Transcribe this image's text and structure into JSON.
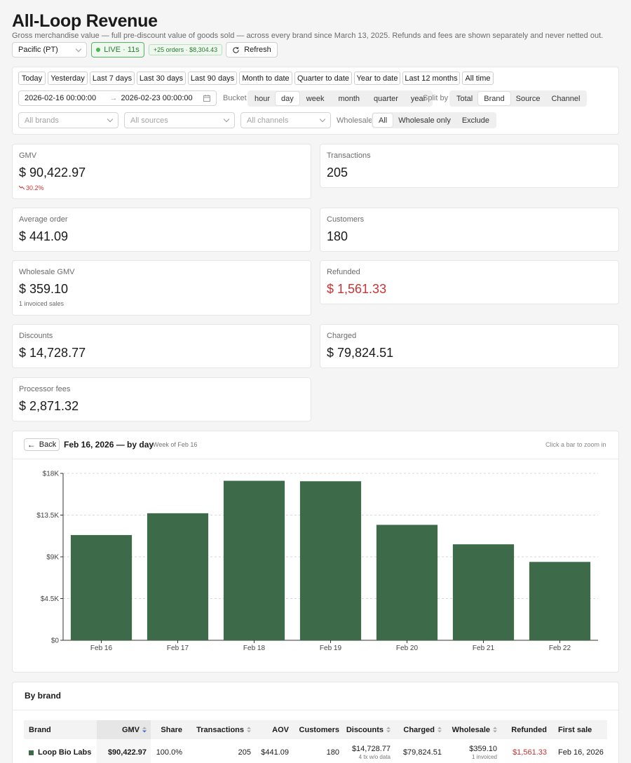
{
  "header": {
    "title": "All-Loop Revenue",
    "subtitle": "Gross merchandise value — full pre-discount value of goods sold — across every brand since March 13, 2025. Refunds and fees are shown separately and never netted out."
  },
  "toolbar": {
    "timezone": "Pacific (PT)",
    "live_label": "LIVE · 11s",
    "new_orders": "+25 orders · $8,304.43",
    "refresh_label": "Refresh"
  },
  "filters": {
    "quick_ranges": [
      "Today",
      "Yesterday",
      "Last 7 days",
      "Last 30 days",
      "Last 90 days",
      "Month to date",
      "Quarter to date",
      "Year to date",
      "Last 12 months",
      "All time"
    ],
    "date_from": "2026-02-16 00:00:00",
    "date_arrow": "→",
    "date_to": "2026-02-23 00:00:00",
    "bucket_label": "Bucket",
    "buckets": [
      "hour",
      "day",
      "week",
      "month",
      "quarter",
      "year"
    ],
    "bucket_selected": "day",
    "split_label": "Split by",
    "splits": [
      "Total",
      "Brand",
      "Source",
      "Channel"
    ],
    "split_selected": "Brand",
    "brands_placeholder": "All brands",
    "sources_placeholder": "All sources",
    "channels_placeholder": "All channels",
    "wholesale_label": "Wholesale",
    "wholesale_options": [
      "All",
      "Wholesale only",
      "Exclude"
    ],
    "wholesale_selected": "All"
  },
  "stats": {
    "gmv": {
      "label": "GMV",
      "value": "$ 90,422.97",
      "delta": "30.2%",
      "delta_color": "#c93333"
    },
    "transactions": {
      "label": "Transactions",
      "value": "205"
    },
    "average_order": {
      "label": "Average order",
      "value": "$ 441.09"
    },
    "customers": {
      "label": "Customers",
      "value": "180"
    },
    "wholesale_gmv": {
      "label": "Wholesale GMV",
      "value": "$ 359.10",
      "note": "1 invoiced sales"
    },
    "refunded": {
      "label": "Refunded",
      "value": "$ 1,561.33",
      "color": "#c93333"
    },
    "discounts": {
      "label": "Discounts",
      "value": "$ 14,728.77"
    },
    "charged": {
      "label": "Charged",
      "value": "$ 79,824.51"
    },
    "processor_fees": {
      "label": "Processor fees",
      "value": "$ 2,871.32"
    }
  },
  "chart_panel": {
    "back_label": "Back",
    "title": "Feb 16, 2026 — by day",
    "subtitle": "Week of Feb 16",
    "hint": "Click a bar to zoom in"
  },
  "chart_data": {
    "type": "bar",
    "categories": [
      "Feb 16",
      "Feb 17",
      "Feb 18",
      "Feb 19",
      "Feb 20",
      "Feb 21",
      "Feb 22"
    ],
    "values": [
      11350,
      13700,
      17200,
      17150,
      12450,
      10350,
      8450
    ],
    "ylim": [
      0,
      18000
    ],
    "yticks": [
      0,
      4500,
      9000,
      13500,
      18000
    ],
    "ytick_labels": [
      "$0",
      "$4.5K",
      "$9K",
      "$13.5K",
      "$18K"
    ],
    "bar_color": "#3d6b4a",
    "grid": true,
    "title": "",
    "xlabel": "",
    "ylabel": ""
  },
  "brand_table": {
    "title": "By brand",
    "columns": [
      "Brand",
      "GMV",
      "Share",
      "Transactions",
      "AOV",
      "Customers",
      "Discounts",
      "Charged",
      "Wholesale",
      "Refunded",
      "First sale"
    ],
    "rows": [
      {
        "brand": "Loop Bio Labs",
        "swatch": "#3d6b4a",
        "gmv": "$90,422.97",
        "share": "100.0%",
        "transactions": "205",
        "aov": "$441.09",
        "customers": "180",
        "discounts": "$14,728.77",
        "discounts_note": "4 tx w/o data",
        "charged": "$79,824.51",
        "wholesale": "$359.10",
        "wholesale_note": "1 invoiced",
        "refunded": "$1,561.33",
        "first_sale": "Feb 16, 2026"
      }
    ]
  }
}
